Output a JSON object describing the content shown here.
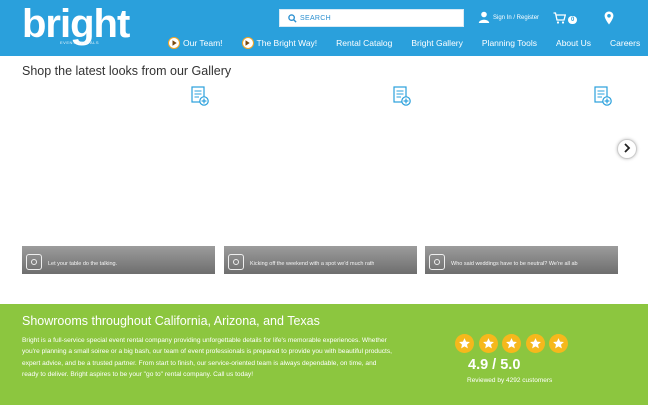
{
  "brand": {
    "logo_text": "bright",
    "tagline": "EVENT RENTALS"
  },
  "header": {
    "search_placeholder": "SEARCH",
    "signin_label": "Sign In / Register",
    "cart_count": "0"
  },
  "nav": {
    "items": [
      {
        "label": "Our Team!",
        "icon": "play-icon"
      },
      {
        "label": "The Bright Way!",
        "icon": "play-icon"
      },
      {
        "label": "Rental Catalog"
      },
      {
        "label": "Bright Gallery"
      },
      {
        "label": "Planning Tools"
      },
      {
        "label": "About Us"
      },
      {
        "label": "Careers"
      }
    ]
  },
  "gallery": {
    "title": "Shop the latest looks from our Gallery",
    "cards": [
      {
        "caption": "Let your table do the talking."
      },
      {
        "caption": "Kicking off the weekend with a spot we'd much rath"
      },
      {
        "caption": "Who said weddings have to be neutral? We're all ab"
      }
    ]
  },
  "showrooms": {
    "title": "Showrooms throughout California, Arizona, and Texas",
    "body": "Bright is a full-service special event rental company providing unforgettable details for life's memorable experiences. Whether you're planning a small soiree or a big bash, our team of event professionals is prepared to provide you with beautiful products, expert advice, and be a trusted partner. From start to finish, our service-oriented team is always dependable, on time, and ready to deliver. Bright aspires to be your \"go to\" rental company. Call us today!",
    "rating": "4.9 / 5.0",
    "reviews": "Reviewed by 4292 customers",
    "stars": 5
  },
  "colors": {
    "header_bg": "#2aa0dc",
    "showroom_bg": "#8cc63f",
    "star": "#f6b81c",
    "accent_orange": "#f5a623"
  }
}
